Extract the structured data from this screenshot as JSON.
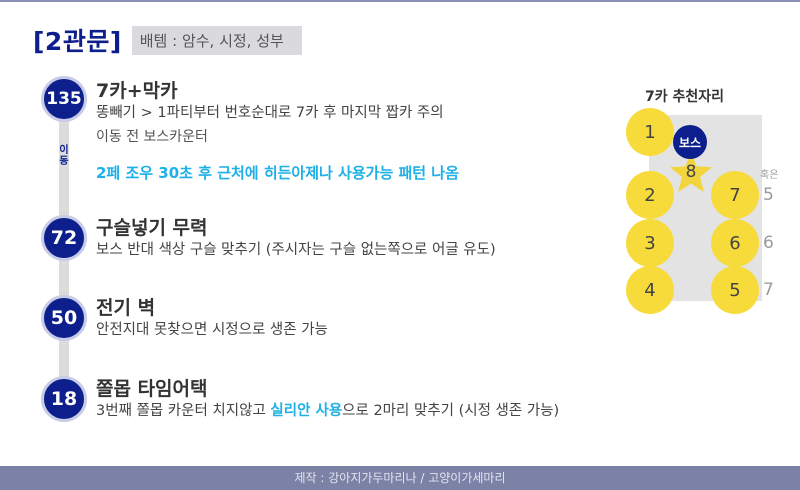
{
  "header": {
    "title": "[2관문]",
    "tag": "배템 : 암수, 시정, 성부"
  },
  "timeline": {
    "move_label": "이동"
  },
  "steps": [
    {
      "badge": "135",
      "title": "7카+막카",
      "desc": "똥빼기 > 1파티부터 번호순대로 7카 후 마지막 짭카 주의",
      "sub": "이동 전 보스카운터",
      "note": "2페 조우 30초 후 근처에 히든아제나 사용가능 패턴 나옴"
    },
    {
      "badge": "72",
      "title": "구슬넣기 무력",
      "desc": "보스 반대 색상 구슬 맞추기 (주시자는 구슬 없는쪽으로 어글 유도)"
    },
    {
      "badge": "50",
      "title": "전기 벽",
      "desc": "안전지대 못찾으면 시정으로 생존 가능"
    },
    {
      "badge": "18",
      "title": "쫄몹 타임어택",
      "desc_before": "3번째 쫄몹 카운터 치지않고 ",
      "desc_highlight": "실리안 사용",
      "desc_after": "으로 2마리 맞추기 (시정 생존 가능)"
    }
  ],
  "map": {
    "title": "7카 추천자리",
    "boss_label": "보스",
    "or_label": "혹은",
    "spots": [
      "1",
      "2",
      "3",
      "4",
      "5",
      "6",
      "7"
    ],
    "star_num": "8",
    "alt_nums": [
      "5",
      "6",
      "7"
    ],
    "colors": {
      "spot": "#f7db3b",
      "boss": "#0d1f8c",
      "star": "#f2d53c"
    }
  },
  "footer": {
    "credit": "제작 : 강아지가두마리나 / 고양이가세마리"
  }
}
